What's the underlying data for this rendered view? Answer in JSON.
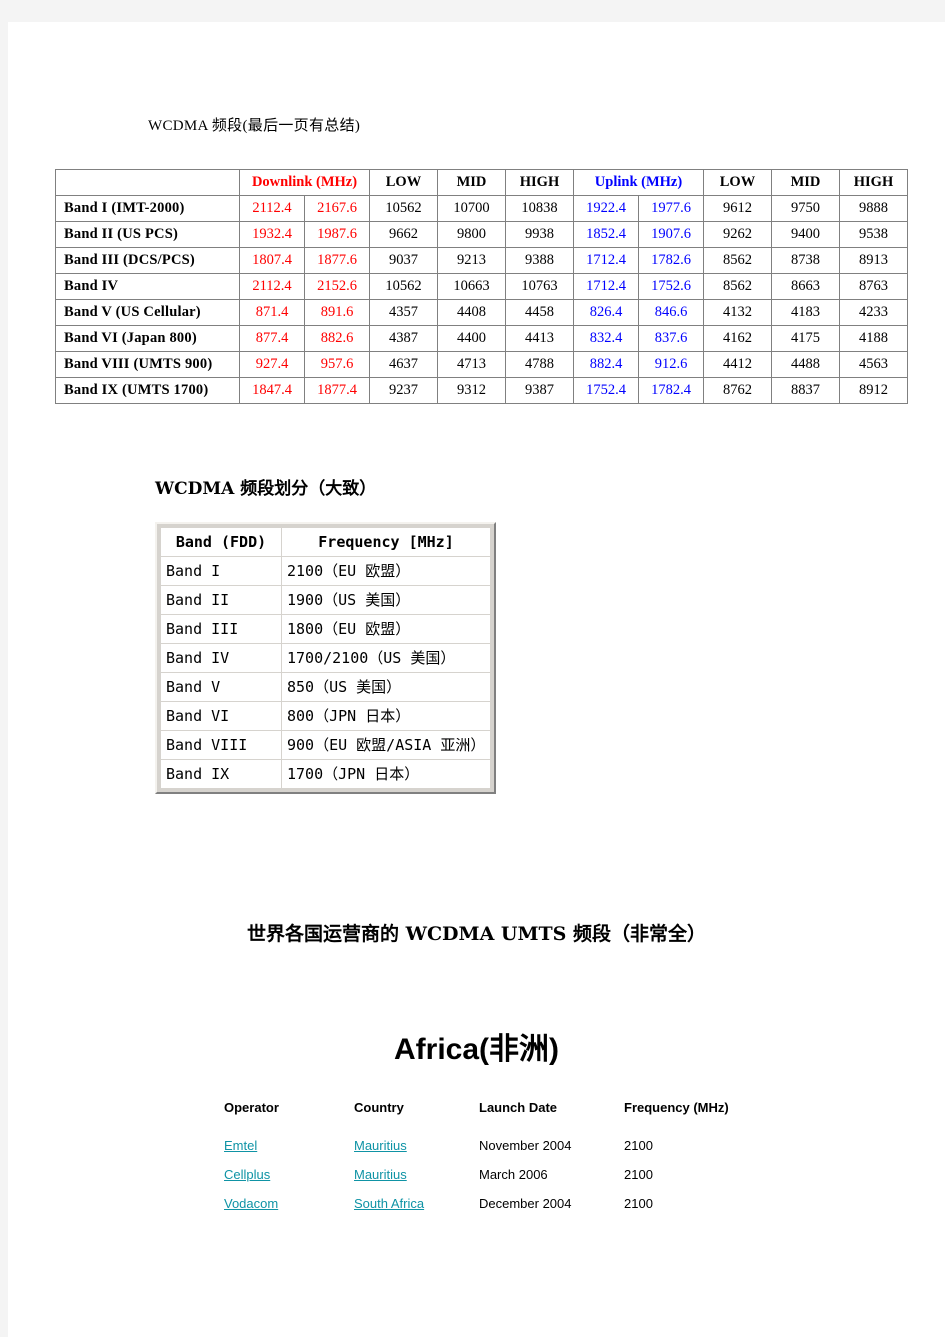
{
  "document": {
    "heading_1": "WCDMA 频段(最后一页有总结)",
    "heading_2": "WCDMA 频段划分（大致）",
    "heading_3": "世界各国运营商的 WCDMA UMTS 频段（非常全）",
    "heading_4": "Africa(非洲)"
  },
  "colors": {
    "downlink": "#FF0000",
    "uplink": "#0000FF",
    "link": "#0F93A5",
    "table_border": "#808080",
    "page_bg": "#FFFFFF",
    "canvas_bg": "#F4F4F4"
  },
  "band_table": {
    "headers": {
      "blank": "",
      "downlink": "Downlink (MHz)",
      "uplink": "Uplink (MHz)",
      "low": "LOW",
      "mid": "MID",
      "high": "HIGH"
    },
    "rows": [
      {
        "name": "Band I (IMT-2000)",
        "dl_low": "2112.4",
        "dl_high": "2167.6",
        "dl_ch_low": "10562",
        "dl_ch_mid": "10700",
        "dl_ch_high": "10838",
        "ul_low": "1922.4",
        "ul_high": "1977.6",
        "ul_ch_low": "9612",
        "ul_ch_mid": "9750",
        "ul_ch_high": "9888"
      },
      {
        "name": "Band II (US PCS)",
        "dl_low": "1932.4",
        "dl_high": "1987.6",
        "dl_ch_low": "9662",
        "dl_ch_mid": "9800",
        "dl_ch_high": "9938",
        "ul_low": "1852.4",
        "ul_high": "1907.6",
        "ul_ch_low": "9262",
        "ul_ch_mid": "9400",
        "ul_ch_high": "9538"
      },
      {
        "name": "Band III (DCS/PCS)",
        "dl_low": "1807.4",
        "dl_high": "1877.6",
        "dl_ch_low": "9037",
        "dl_ch_mid": "9213",
        "dl_ch_high": "9388",
        "ul_low": "1712.4",
        "ul_high": "1782.6",
        "ul_ch_low": "8562",
        "ul_ch_mid": "8738",
        "ul_ch_high": "8913"
      },
      {
        "name": "Band IV",
        "dl_low": "2112.4",
        "dl_high": "2152.6",
        "dl_ch_low": "10562",
        "dl_ch_mid": "10663",
        "dl_ch_high": "10763",
        "ul_low": "1712.4",
        "ul_high": "1752.6",
        "ul_ch_low": "8562",
        "ul_ch_mid": "8663",
        "ul_ch_high": "8763"
      },
      {
        "name": "Band V (US Cellular)",
        "dl_low": "871.4",
        "dl_high": "891.6",
        "dl_ch_low": "4357",
        "dl_ch_mid": "4408",
        "dl_ch_high": "4458",
        "ul_low": "826.4",
        "ul_high": "846.6",
        "ul_ch_low": "4132",
        "ul_ch_mid": "4183",
        "ul_ch_high": "4233"
      },
      {
        "name": "Band VI (Japan 800)",
        "dl_low": "877.4",
        "dl_high": "882.6",
        "dl_ch_low": "4387",
        "dl_ch_mid": "4400",
        "dl_ch_high": "4413",
        "ul_low": "832.4",
        "ul_high": "837.6",
        "ul_ch_low": "4162",
        "ul_ch_mid": "4175",
        "ul_ch_high": "4188"
      },
      {
        "name": "Band VIII (UMTS 900)",
        "dl_low": "927.4",
        "dl_high": "957.6",
        "dl_ch_low": "4637",
        "dl_ch_mid": "4713",
        "dl_ch_high": "4788",
        "ul_low": "882.4",
        "ul_high": "912.6",
        "ul_ch_low": "4412",
        "ul_ch_mid": "4488",
        "ul_ch_high": "4563"
      },
      {
        "name": "Band IX (UMTS 1700)",
        "dl_low": "1847.4",
        "dl_high": "1877.4",
        "dl_ch_low": "9237",
        "dl_ch_mid": "9312",
        "dl_ch_high": "9387",
        "ul_low": "1752.4",
        "ul_high": "1782.4",
        "ul_ch_low": "8762",
        "ul_ch_mid": "8837",
        "ul_ch_high": "8912"
      }
    ]
  },
  "fdd_table": {
    "headers": {
      "band": "Band (FDD)",
      "frequency": "Frequency [MHz]"
    },
    "rows": [
      {
        "band": "Band I",
        "frequency": "2100（EU 欧盟）"
      },
      {
        "band": "Band II",
        "frequency": "1900（US 美国）"
      },
      {
        "band": "Band III",
        "frequency": "1800（EU 欧盟）"
      },
      {
        "band": "Band IV",
        "frequency": "1700/2100（US 美国）"
      },
      {
        "band": "Band V",
        "frequency": "850（US 美国）"
      },
      {
        "band": "Band VI",
        "frequency": "800（JPN 日本）"
      },
      {
        "band": "Band VIII",
        "frequency": "900（EU 欧盟/ASIA 亚洲）"
      },
      {
        "band": "Band IX",
        "frequency": "1700（JPN 日本）"
      }
    ]
  },
  "operator_table": {
    "headers": {
      "operator": "Operator",
      "country": "Country",
      "launch_date": "Launch Date",
      "frequency": "Frequency (MHz)"
    },
    "rows": [
      {
        "operator": "Emtel",
        "country": "Mauritius",
        "launch_date": "November 2004",
        "frequency": "2100"
      },
      {
        "operator": "Cellplus",
        "country": "Mauritius",
        "launch_date": "March 2006",
        "frequency": "2100"
      },
      {
        "operator": "Vodacom",
        "country": "South Africa",
        "launch_date": "December 2004",
        "frequency": "2100"
      }
    ]
  }
}
